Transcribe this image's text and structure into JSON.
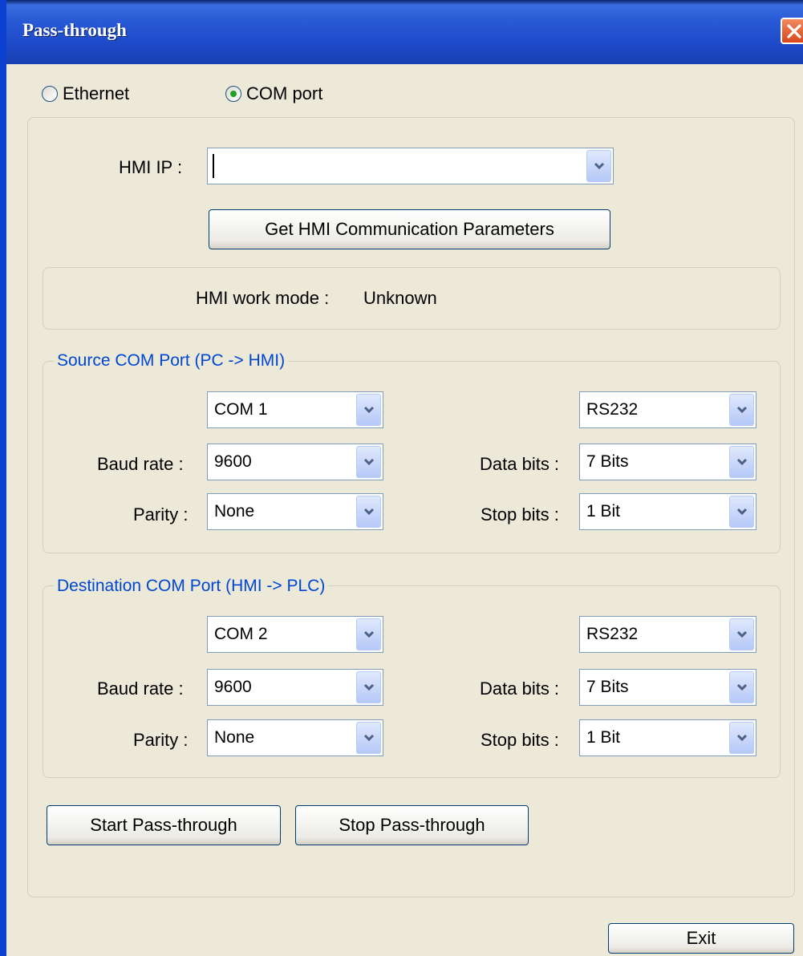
{
  "window": {
    "title": "Pass-through"
  },
  "connection": {
    "ethernet_label": "Ethernet",
    "com_label": "COM port",
    "selected": "COM port"
  },
  "hmi": {
    "ip_label": "HMI IP :",
    "ip_value": "",
    "get_params_button": "Get HMI  Communication Parameters",
    "work_mode_label": "HMI work mode :",
    "work_mode_value": "Unknown"
  },
  "source": {
    "legend": "Source COM Port (PC -> HMI)",
    "port": "COM 1",
    "interface": "RS232",
    "baud_label": "Baud rate :",
    "baud": "9600",
    "data_bits_label": "Data bits :",
    "data_bits": "7 Bits",
    "parity_label": "Parity :",
    "parity": "None",
    "stop_bits_label": "Stop bits :",
    "stop_bits": "1 Bit"
  },
  "destination": {
    "legend": "Destination COM Port (HMI -> PLC)",
    "port": "COM 2",
    "interface": "RS232",
    "baud_label": "Baud rate :",
    "baud": "9600",
    "data_bits_label": "Data bits :",
    "data_bits": "7 Bits",
    "parity_label": "Parity :",
    "parity": "None",
    "stop_bits_label": "Stop bits :",
    "stop_bits": "1 Bit"
  },
  "actions": {
    "start": "Start Pass-through",
    "stop": "Stop Pass-through",
    "exit": "Exit"
  },
  "colors": {
    "title_bar": "#1c49c8",
    "group_legend": "#0046d5",
    "dialog_bg": "#ece9d8",
    "radio_selected": "#21a121"
  }
}
